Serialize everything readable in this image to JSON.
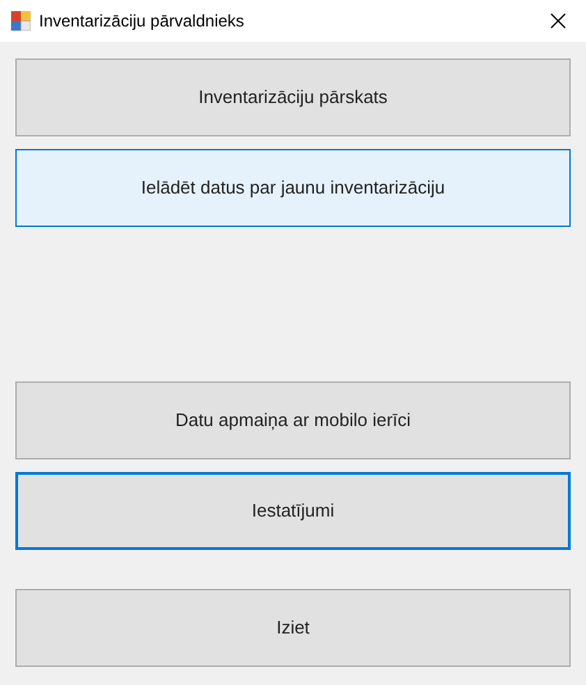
{
  "window": {
    "title": "Inventarizāciju pārvaldnieks"
  },
  "button_groups": [
    [
      {
        "label": "Inventarizāciju pārskats",
        "hovered": false,
        "focused": false
      },
      {
        "label": "Ielādēt datus par jaunu inventarizāciju",
        "hovered": true,
        "focused": false
      }
    ],
    [
      {
        "label": "Datu apmaiņa ar mobilo ierīci",
        "hovered": false,
        "focused": false
      },
      {
        "label": "Iestatījumi",
        "hovered": false,
        "focused": true
      }
    ],
    [
      {
        "label": "Iziet",
        "hovered": false,
        "focused": false
      }
    ]
  ]
}
